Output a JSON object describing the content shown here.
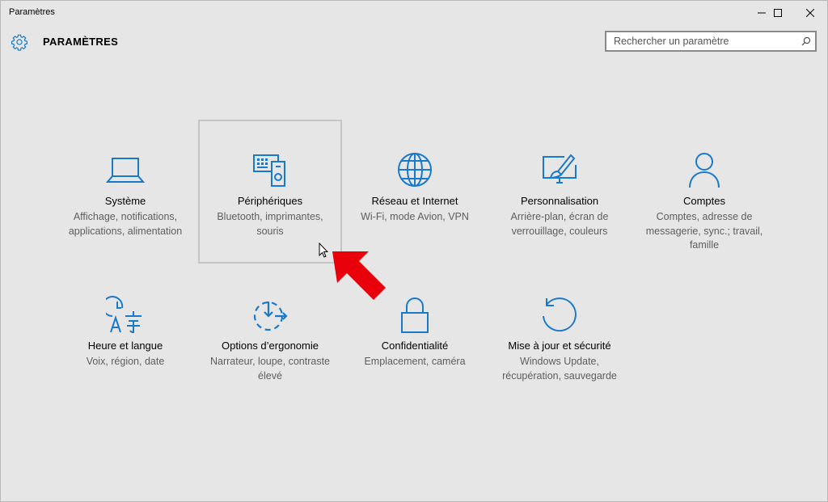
{
  "window": {
    "title": "Paramètres",
    "controls": [
      "minimize-icon",
      "maximize-icon",
      "close-icon"
    ]
  },
  "header": {
    "title": "PARAMÈTRES",
    "icon": "gear-icon"
  },
  "search": {
    "placeholder": "Rechercher un paramètre",
    "value": "",
    "icon": "search-icon"
  },
  "accent_color": "#1979ca",
  "tiles": [
    {
      "name": "Système",
      "desc": "Affichage, notifications, applications, alimentation",
      "icon": "laptop-icon"
    },
    {
      "name": "Périphériques",
      "desc": "Bluetooth, imprimantes, souris",
      "icon": "devices-icon",
      "hovered": true
    },
    {
      "name": "Réseau et Internet",
      "desc": "Wi-Fi, mode Avion, VPN",
      "icon": "globe-icon"
    },
    {
      "name": "Personnalisation",
      "desc": "Arrière-plan, écran de verrouillage, couleurs",
      "icon": "personalization-icon"
    },
    {
      "name": "Comptes",
      "desc": "Comptes, adresse de messagerie, sync.; travail, famille",
      "icon": "person-icon"
    },
    {
      "name": "Heure et langue",
      "desc": "Voix, région, date",
      "icon": "time-language-icon"
    },
    {
      "name": "Options d’ergonomie",
      "desc": "Narrateur, loupe, contraste élevé",
      "icon": "ease-of-access-icon"
    },
    {
      "name": "Confidentialité",
      "desc": "Emplacement, caméra",
      "icon": "lock-icon"
    },
    {
      "name": "Mise à jour et sécurité",
      "desc": "Windows Update, récupération, sauvegarde",
      "icon": "update-icon"
    }
  ],
  "annotation": {
    "icon": "red-arrow-icon",
    "color": "#e8000b"
  }
}
